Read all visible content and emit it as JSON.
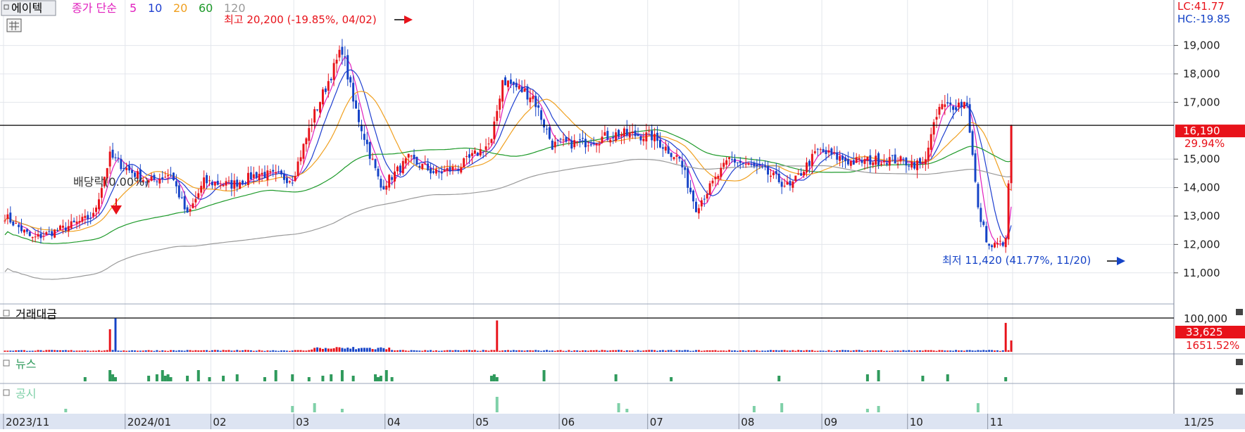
{
  "header": {
    "stock_button": "에이텍",
    "ma_label": "종가 단순",
    "ma_periods": [
      {
        "label": "5",
        "color": "#e11fbe"
      },
      {
        "label": "10",
        "color": "#1f3fd0"
      },
      {
        "label": "20",
        "color": "#f0a020"
      },
      {
        "label": "60",
        "color": "#1e9a2a"
      },
      {
        "label": "120",
        "color": "#9a9a9a"
      }
    ],
    "lc_label": "LC:41.77",
    "hc_label": "HC:-19.85"
  },
  "annotations": {
    "high_label": "최고 20,200 (-19.85%, 04/02)",
    "low_label": "최저 11,420 (41.77%, 11/20)",
    "dividend_label": "배당락(0.00%)"
  },
  "price_axis": {
    "tick_labels": [
      "19,000",
      "18,000",
      "17,000",
      "15,000",
      "14,000",
      "13,000",
      "12,000",
      "11,000"
    ],
    "current_price": "16,190",
    "current_change": "29.94%"
  },
  "volume_panel": {
    "title": "거래대금",
    "axis_max": "100,000",
    "current_value": "33,625",
    "current_change": "1651.52%"
  },
  "news_panel": {
    "title": "뉴스"
  },
  "disclosure_panel": {
    "title": "공시"
  },
  "date_axis": {
    "labels": [
      "2023/11",
      "2024/01",
      "02",
      "03",
      "04",
      "05",
      "06",
      "07",
      "08",
      "09",
      "10",
      "11",
      "11/25"
    ]
  },
  "colors": {
    "up": "#e8121a",
    "down": "#1543c7",
    "ma5": "#e11fbe",
    "ma10": "#1f3fd0",
    "ma20": "#f0a020",
    "ma60": "#1e9a2a",
    "ma120": "#9a9a9a",
    "news": "#2f9a5c",
    "disclosure": "#7fd0a8"
  },
  "chart_data": {
    "type": "candlestick",
    "y_range": [
      10500,
      20400
    ],
    "current_price": 16190,
    "high": {
      "value": 20200,
      "date": "04/02"
    },
    "low": {
      "value": 11420,
      "date": "11/20"
    },
    "price_anchors": [
      {
        "t": 0,
        "p": 13000
      },
      {
        "t": 10,
        "p": 12200
      },
      {
        "t": 22,
        "p": 12600
      },
      {
        "t": 32,
        "p": 13000
      },
      {
        "t": 38,
        "p": 15100
      },
      {
        "t": 45,
        "p": 14600
      },
      {
        "t": 52,
        "p": 14200
      },
      {
        "t": 60,
        "p": 14500
      },
      {
        "t": 66,
        "p": 13000
      },
      {
        "t": 72,
        "p": 14200
      },
      {
        "t": 82,
        "p": 14100
      },
      {
        "t": 92,
        "p": 14500
      },
      {
        "t": 104,
        "p": 14300
      },
      {
        "t": 112,
        "p": 16600
      },
      {
        "t": 122,
        "p": 18900
      },
      {
        "t": 126,
        "p": 17000
      },
      {
        "t": 136,
        "p": 14000
      },
      {
        "t": 146,
        "p": 15000
      },
      {
        "t": 156,
        "p": 14500
      },
      {
        "t": 164,
        "p": 14700
      },
      {
        "t": 176,
        "p": 15600
      },
      {
        "t": 180,
        "p": 17800
      },
      {
        "t": 191,
        "p": 17200
      },
      {
        "t": 198,
        "p": 15500
      },
      {
        "t": 210,
        "p": 15600
      },
      {
        "t": 222,
        "p": 15900
      },
      {
        "t": 234,
        "p": 15800
      },
      {
        "t": 244,
        "p": 15000
      },
      {
        "t": 250,
        "p": 13300
      },
      {
        "t": 262,
        "p": 15000
      },
      {
        "t": 274,
        "p": 14600
      },
      {
        "t": 284,
        "p": 14000
      },
      {
        "t": 294,
        "p": 15300
      },
      {
        "t": 306,
        "p": 14900
      },
      {
        "t": 320,
        "p": 15000
      },
      {
        "t": 332,
        "p": 14800
      },
      {
        "t": 338,
        "p": 16800
      },
      {
        "t": 348,
        "p": 17000
      },
      {
        "t": 352,
        "p": 13200
      },
      {
        "t": 356,
        "p": 11900
      },
      {
        "t": 362,
        "p": 12100
      },
      {
        "t": 364,
        "p": 16190
      }
    ],
    "moving_averages": [
      5,
      10,
      20,
      60,
      120
    ],
    "volume_axis_max": 100000,
    "volume_current": 33625,
    "volume_spike_days": [
      38,
      40,
      178,
      362
    ],
    "news_days": [
      29,
      38,
      39,
      40,
      52,
      55,
      57,
      58,
      59,
      60,
      66,
      70,
      74,
      79,
      84,
      94,
      98,
      104,
      110,
      115,
      118,
      122,
      126,
      134,
      135,
      136,
      138,
      140,
      176,
      177,
      178,
      195,
      221,
      241,
      280,
      312,
      316,
      332,
      341,
      362
    ],
    "disclosure_days": [
      22,
      104,
      112,
      122,
      178,
      222,
      225,
      271,
      281,
      312,
      316,
      352
    ]
  }
}
